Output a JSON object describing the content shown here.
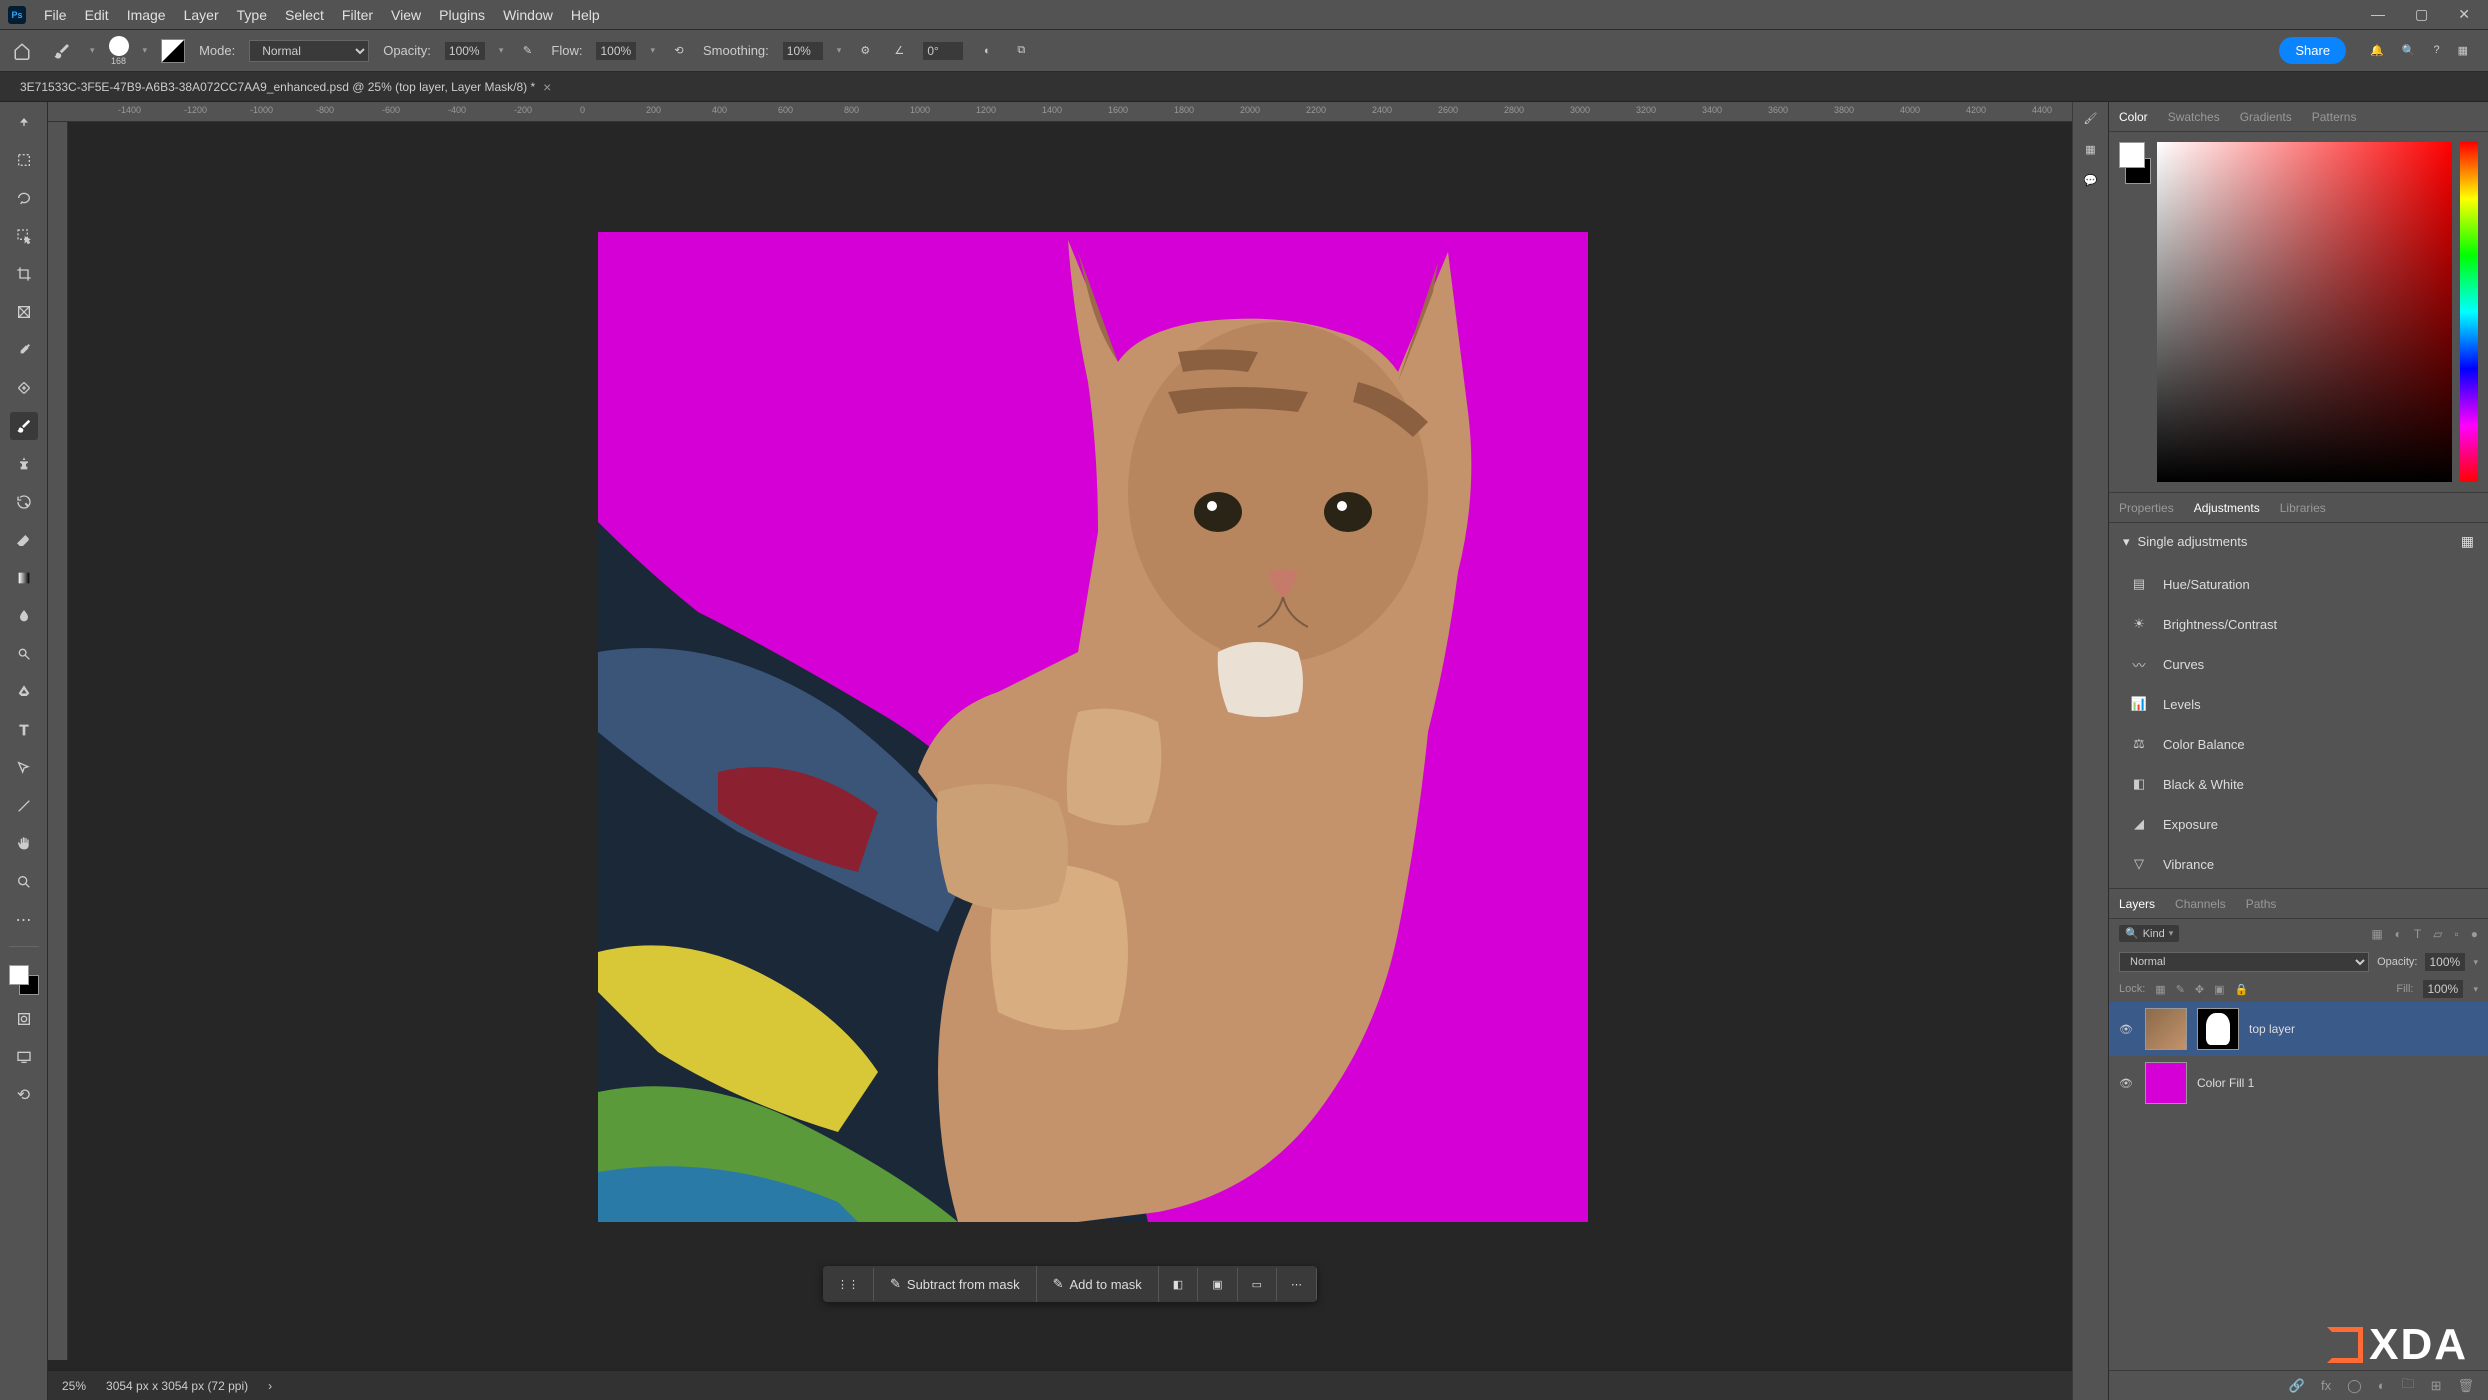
{
  "menubar": {
    "items": [
      "File",
      "Edit",
      "Image",
      "Layer",
      "Type",
      "Select",
      "Filter",
      "View",
      "Plugins",
      "Window",
      "Help"
    ]
  },
  "options": {
    "brush_size": "168",
    "mode_label": "Mode:",
    "mode_value": "Normal",
    "opacity_label": "Opacity:",
    "opacity_value": "100%",
    "flow_label": "Flow:",
    "flow_value": "100%",
    "smoothing_label": "Smoothing:",
    "smoothing_value": "10%",
    "angle_value": "0°",
    "share": "Share"
  },
  "document": {
    "tab_title": "3E71533C-3F5E-47B9-A6B3-38A072CC7AA9_enhanced.psd @ 25% (top layer, Layer Mask/8) *"
  },
  "ruler_ticks": [
    "-1400",
    "-1200",
    "-1000",
    "-800",
    "-600",
    "-400",
    "-200",
    "0",
    "200",
    "400",
    "600",
    "800",
    "1000",
    "1200",
    "1400",
    "1600",
    "1800",
    "2000",
    "2200",
    "2400",
    "2600",
    "2800",
    "3000",
    "3200",
    "3400",
    "3600",
    "3800",
    "4000",
    "4200",
    "4400"
  ],
  "quick_actions": {
    "subtract": "Subtract from mask",
    "add": "Add to mask"
  },
  "status": {
    "zoom": "25%",
    "dimensions": "3054 px x 3054 px (72 ppi)"
  },
  "panels": {
    "color_tabs": [
      "Color",
      "Swatches",
      "Gradients",
      "Patterns"
    ],
    "color_active": 0,
    "props_tabs": [
      "Properties",
      "Adjustments",
      "Libraries"
    ],
    "props_active": 1,
    "adjustments_header": "Single adjustments",
    "adjustments": [
      "Hue/Saturation",
      "Brightness/Contrast",
      "Curves",
      "Levels",
      "Color Balance",
      "Black & White",
      "Exposure",
      "Vibrance"
    ],
    "layers_tabs": [
      "Layers",
      "Channels",
      "Paths"
    ],
    "layers_active": 0,
    "layer_filter_label": "Kind",
    "blend_mode": "Normal",
    "layer_opacity_label": "Opacity:",
    "layer_opacity": "100%",
    "lock_label": "Lock:",
    "fill_label": "Fill:",
    "fill_value": "100%",
    "layers": [
      {
        "name": "top layer",
        "has_mask": true,
        "selected": true
      },
      {
        "name": "Color Fill 1",
        "has_mask": false,
        "selected": false
      }
    ]
  },
  "colors": {
    "canvas_bg": "#d500d5",
    "accent": "#0a84ff"
  },
  "watermark": "XDA"
}
